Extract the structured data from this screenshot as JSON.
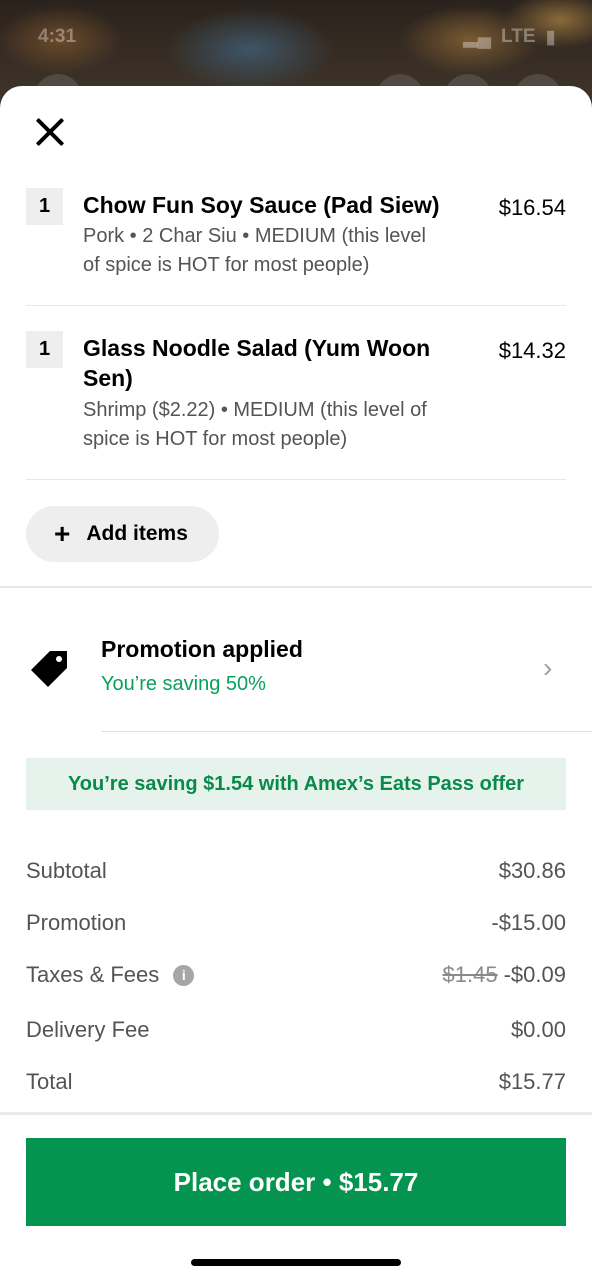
{
  "status_bar": {
    "time": "4:31",
    "network": "LTE"
  },
  "cart": {
    "items": [
      {
        "qty": "1",
        "name": "Chow Fun Soy Sauce (Pad Siew)",
        "price": "$16.54",
        "desc_line1": "Pork • 2 Char Siu • MEDIUM (this level",
        "desc_line2": "of spice is HOT for  most people)"
      },
      {
        "qty": "1",
        "name": "Glass Noodle Salad (Yum Woon Sen)",
        "price": "$14.32",
        "desc_line1": "Shrimp ($2.22) • MEDIUM (this level of",
        "desc_line2": "spice is HOT for  most people)"
      }
    ],
    "add_items_label": "Add items"
  },
  "promotion": {
    "title": "Promotion applied",
    "subtitle": "You’re saving 50%",
    "icon": "tag-icon"
  },
  "eats_pass_banner": "You’re saving $1.54 with Amex’s Eats Pass offer",
  "summary": {
    "subtotal_label": "Subtotal",
    "subtotal": "$30.86",
    "promotion_label": "Promotion",
    "promotion": "-$15.00",
    "taxes_label": "Taxes & Fees",
    "taxes_original": "$1.45",
    "taxes": "-$0.09",
    "delivery_label": "Delivery Fee",
    "delivery": "$0.00",
    "total_label": "Total",
    "total": "$15.77"
  },
  "place_order_label": "Place order • $15.77",
  "colors": {
    "accent_green": "#05944f",
    "promo_green": "#06a35a",
    "banner_bg": "#e5f3ec"
  }
}
